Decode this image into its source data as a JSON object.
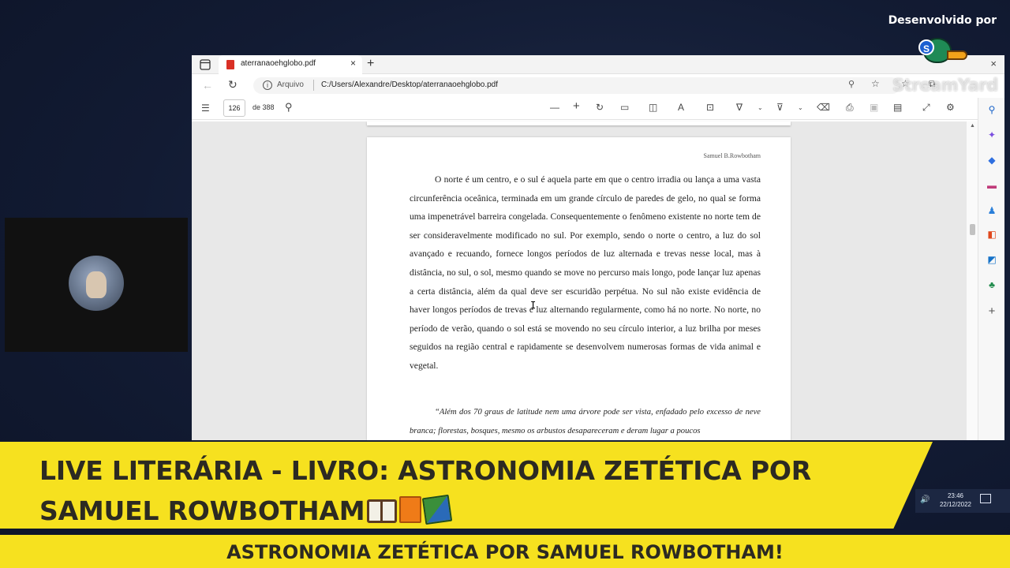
{
  "overlay": {
    "credit": "Desenvolvido por",
    "logo_text": "StreamYard",
    "logo_badge": "S"
  },
  "browser": {
    "tab": {
      "title": "aterranaoehglobo.pdf",
      "close": "×"
    },
    "new_tab": "+",
    "window_close": "×",
    "address": {
      "site_label": "Arquivo",
      "url": "C:/Users/Alexandre/Desktop/aterranaoehglobo.pdf"
    }
  },
  "pdf_toolbar": {
    "page_number": "126",
    "page_count": "de 388"
  },
  "pdf_page": {
    "running_header": "Samuel B.Rowbotham",
    "paragraph": "O norte é um centro, e o sul é aquela parte em que o centro irradia ou lança a uma vasta circunferência oceânica, terminada em um grande círculo de paredes de gelo, no qual se forma uma impenetrável barreira congelada. Consequentemente o fenômeno existente no norte tem de ser consideravelmente modificado no sul. Por exemplo, sendo o norte o centro, a luz do sol avançado e recuando, fornece longos períodos de luz alternada e trevas nesse local, mas à distância, no sul, o sol, mesmo quando se move no percurso mais longo, pode lançar luz apenas a certa distância, além da qual deve ser escuridão perpétua. No sul não existe evidência de haver longos períodos de trevas e luz alternando regularmente, como há no norte. No norte, no período de verão, quando o sol está se movendo no seu círculo interior, a luz brilha por meses seguidos na região central e rapidamente se desenvolvem numerosas formas de vida animal e vegetal.",
    "quote": "“Além dos 70 graus de latitude nem uma árvore pode ser vista, enfadado pelo excesso de neve branca; florestas, bosques, mesmo os arbustos desapareceram e deram lugar a poucos"
  },
  "taskbar": {
    "time": "23:46",
    "date": "22/12/2022"
  },
  "banner": {
    "line1": "LIVE LITERÁRIA - LIVRO: ASTRONOMIA ZETÉTICA POR",
    "line2": "SAMUEL ROWBOTHAM"
  },
  "ticker": {
    "text": "ASTRONOMIA ZETÉTICA POR SAMUEL ROWBOTHAM!"
  },
  "colors": {
    "banner": "#f6e11f",
    "background": "#121b33",
    "pdf_icon": "#d93025"
  }
}
